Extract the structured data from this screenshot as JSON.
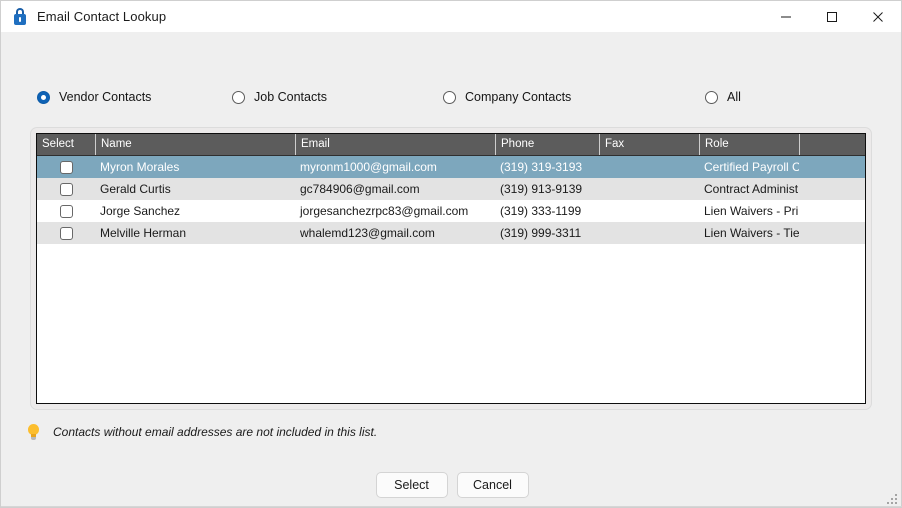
{
  "window": {
    "title": "Email Contact Lookup",
    "title_icon": "lock-icon",
    "controls": {
      "minimize": "minimize-icon",
      "maximize": "maximize-icon",
      "close": "close-icon"
    }
  },
  "filters": {
    "options": [
      {
        "label": "Vendor Contacts",
        "selected": true
      },
      {
        "label": "Job Contacts",
        "selected": false
      },
      {
        "label": "Company Contacts",
        "selected": false
      },
      {
        "label": "All",
        "selected": false
      }
    ]
  },
  "grid": {
    "columns": [
      {
        "key": "select",
        "label": "Select"
      },
      {
        "key": "name",
        "label": "Name"
      },
      {
        "key": "email",
        "label": "Email"
      },
      {
        "key": "phone",
        "label": "Phone"
      },
      {
        "key": "fax",
        "label": "Fax"
      },
      {
        "key": "role",
        "label": "Role"
      },
      {
        "key": "pad",
        "label": ""
      }
    ],
    "rows": [
      {
        "checked": false,
        "selected": true,
        "name": "Myron Morales",
        "email": "myronm1000@gmail.com",
        "phone": "(319) 319-3193",
        "fax": "",
        "role": "Certified Payroll C..."
      },
      {
        "checked": false,
        "selected": false,
        "name": "Gerald Curtis",
        "email": "gc784906@gmail.com",
        "phone": "(319) 913-9139",
        "fax": "",
        "role": "Contract Administ..."
      },
      {
        "checked": false,
        "selected": false,
        "name": "Jorge Sanchez",
        "email": "jorgesanchezrpc83@gmail.com",
        "phone": "(319) 333-1199",
        "fax": "",
        "role": "Lien Waivers - Pri..."
      },
      {
        "checked": false,
        "selected": false,
        "name": "Melville Herman",
        "email": "whalemd123@gmail.com",
        "phone": "(319) 999-3311",
        "fax": "",
        "role": "Lien Waivers - Tier"
      }
    ]
  },
  "hint": {
    "icon": "lightbulb-icon",
    "text": "Contacts without email addresses are not included in this list."
  },
  "actions": {
    "select_label": "Select",
    "cancel_label": "Cancel"
  },
  "colors": {
    "selected_row": "#7da7bd",
    "header_bg": "#5c5c5c",
    "alt_row": "#e3e3e3",
    "dialog_bg": "#efefef",
    "radio_accent": "#0e62b5",
    "lock_accent": "#1f6fc0",
    "bulb": "#fcbe2e"
  }
}
